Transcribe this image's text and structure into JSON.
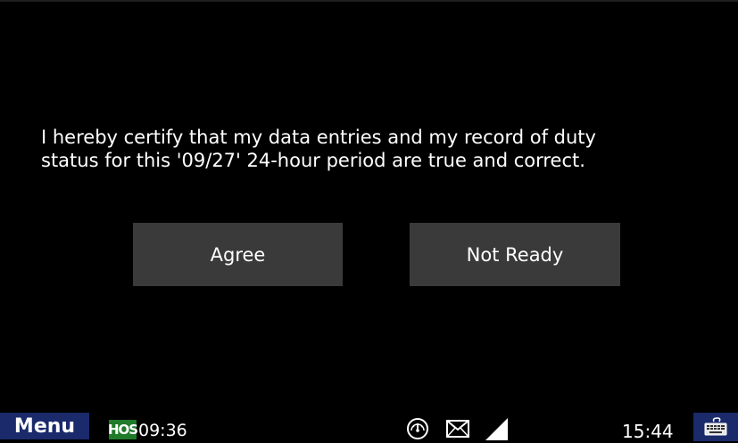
{
  "certification": {
    "line1": "I hereby certify that my data entries and my record of duty",
    "line2": "status for this '09/27' 24-hour period are true and correct."
  },
  "buttons": {
    "agree_label": "Agree",
    "not_ready_label": "Not Ready"
  },
  "taskbar": {
    "menu_label": "Menu",
    "hos_badge": "HOS",
    "hos_time": "09:36",
    "clock": "15:44",
    "icons": [
      "gauge-icon",
      "mail-icon",
      "signal-icon",
      "keyboard-icon"
    ]
  },
  "colors": {
    "background": "#000000",
    "button": "#3a3a3a",
    "menu_blue": "#1a2a6b",
    "hos_green": "#1f7a2a",
    "text": "#ffffff"
  }
}
